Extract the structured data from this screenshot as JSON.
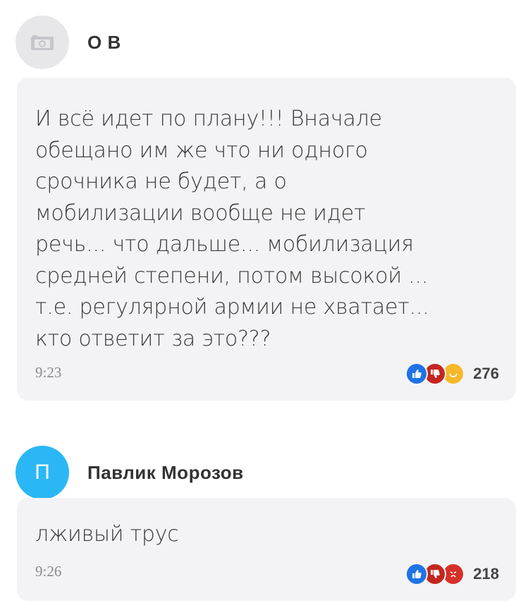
{
  "comments": [
    {
      "author": "О В",
      "avatar_type": "camera-placeholder",
      "text_lines": [
        "И всё идет по плану!!! Вначале",
        "обещано им же что ни одного",
        "срочника не будет, а о",
        "мобилизации вообще не идет",
        "речь... что дальше... мобилизация",
        "средней степени, потом высокой ...",
        "т.е. регулярной армии не хватает...",
        "кто ответит за это???"
      ],
      "time": "9:23",
      "reactions": [
        "like",
        "dislike",
        "smile"
      ],
      "reaction_count": "276"
    },
    {
      "author": "Павлик Морозов",
      "avatar_letter": "П",
      "text_lines": [
        "лживый трус"
      ],
      "time": "9:26",
      "reactions": [
        "like",
        "dislike",
        "angry"
      ],
      "reaction_count": "218"
    }
  ],
  "colors": {
    "bubble_bg": "#f3f3f5",
    "avatar_letter_bg": "#2bb7f6",
    "like": "#1e74e4",
    "dislike": "#c4261e",
    "smile": "#f5b82a"
  }
}
